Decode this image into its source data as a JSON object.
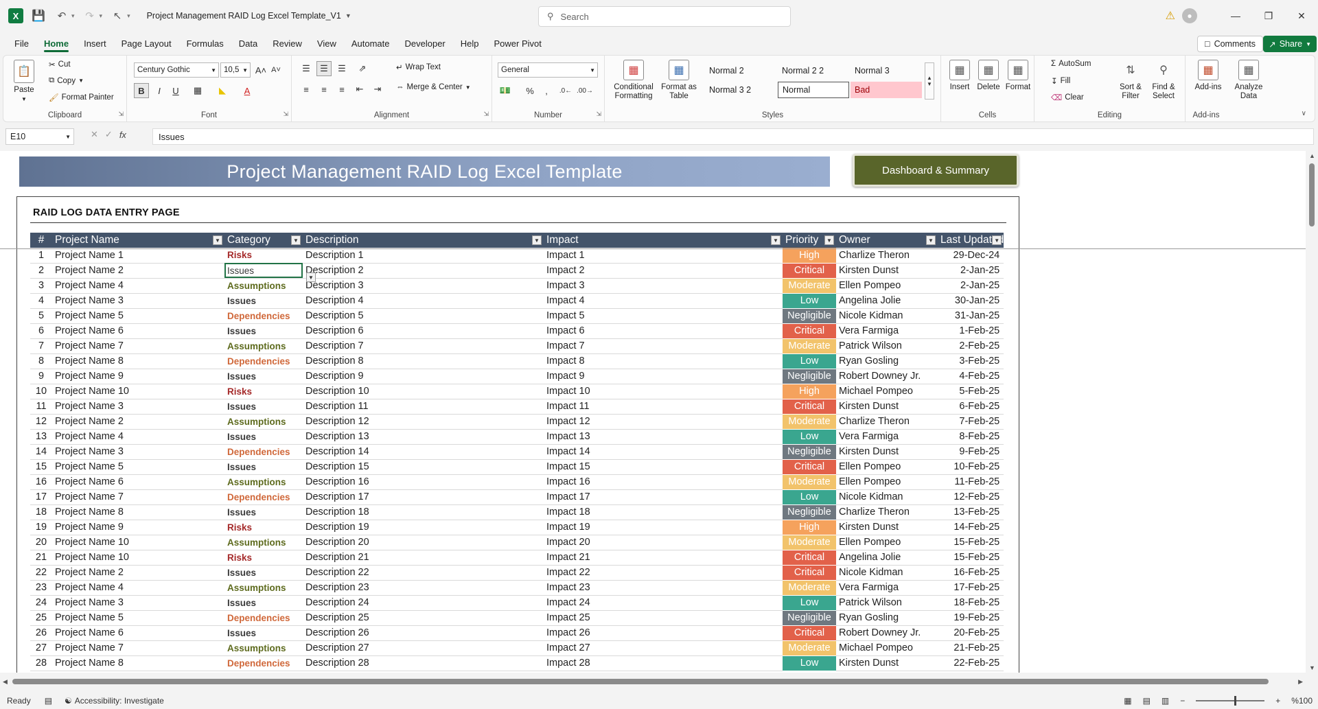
{
  "app": {
    "title": "Project Management RAID Log Excel Template_V1",
    "search_placeholder": "Search",
    "comments_label": "Comments",
    "share_label": "Share"
  },
  "menu": [
    "File",
    "Home",
    "Insert",
    "Page Layout",
    "Formulas",
    "Data",
    "Review",
    "View",
    "Automate",
    "Developer",
    "Help",
    "Power Pivot"
  ],
  "ribbon": {
    "clipboard": {
      "paste": "Paste",
      "cut": "Cut",
      "copy": "Copy",
      "format_painter": "Format Painter",
      "label": "Clipboard"
    },
    "font": {
      "name": "Century Gothic",
      "size": "10,5",
      "label": "Font"
    },
    "alignment": {
      "wrap_text": "Wrap Text",
      "merge_center": "Merge & Center",
      "label": "Alignment"
    },
    "number": {
      "format": "General",
      "label": "Number"
    },
    "styles": {
      "conditional_formatting": "Conditional Formatting",
      "format_as_table": "Format as Table",
      "cells": [
        "Normal 2",
        "Normal 2 2",
        "Normal 3",
        "Normal 3 2",
        "Normal",
        "Bad"
      ],
      "label": "Styles"
    },
    "cells": {
      "insert": "Insert",
      "delete": "Delete",
      "format": "Format",
      "label": "Cells"
    },
    "editing": {
      "autosum": "AutoSum",
      "fill": "Fill",
      "clear": "Clear",
      "sort_filter": "Sort & Filter",
      "find_select": "Find & Select",
      "label": "Editing"
    },
    "addins": {
      "addins": "Add-ins",
      "analyze": "Analyze Data",
      "label": "Add-ins"
    }
  },
  "formula_bar": {
    "name_box": "E10",
    "value": "Issues"
  },
  "sheet": {
    "banner_title": "Project Management RAID Log Excel Template",
    "dashboard_button": "Dashboard & Summary",
    "entry_title": "RAID LOG DATA ENTRY PAGE",
    "headers": [
      "#",
      "Project Name",
      "Category",
      "Description",
      "Impact",
      "Priority",
      "Owner",
      "Last Updated"
    ],
    "rows": [
      [
        "1",
        "Project Name 1",
        "Risks",
        "Description 1",
        "Impact 1",
        "High",
        "Charlize Theron",
        "29-Dec-24"
      ],
      [
        "2",
        "Project Name 2",
        "Issues",
        "Description 2",
        "Impact 2",
        "Critical",
        "Kirsten Dunst",
        "2-Jan-25"
      ],
      [
        "3",
        "Project Name 4",
        "Assumptions",
        "Description 3",
        "Impact 3",
        "Moderate",
        "Ellen Pompeo",
        "2-Jan-25"
      ],
      [
        "4",
        "Project Name 3",
        "Issues",
        "Description 4",
        "Impact 4",
        "Low",
        "Angelina Jolie",
        "30-Jan-25"
      ],
      [
        "5",
        "Project Name 5",
        "Dependencies",
        "Description 5",
        "Impact 5",
        "Negligible",
        "Nicole Kidman",
        "31-Jan-25"
      ],
      [
        "6",
        "Project Name 6",
        "Issues",
        "Description 6",
        "Impact 6",
        "Critical",
        "Vera Farmiga",
        "1-Feb-25"
      ],
      [
        "7",
        "Project Name 7",
        "Assumptions",
        "Description 7",
        "Impact 7",
        "Moderate",
        "Patrick Wilson",
        "2-Feb-25"
      ],
      [
        "8",
        "Project Name 8",
        "Dependencies",
        "Description 8",
        "Impact 8",
        "Low",
        "Ryan Gosling",
        "3-Feb-25"
      ],
      [
        "9",
        "Project Name 9",
        "Issues",
        "Description 9",
        "Impact 9",
        "Negligible",
        "Robert Downey Jr.",
        "4-Feb-25"
      ],
      [
        "10",
        "Project Name 10",
        "Risks",
        "Description 10",
        "Impact 10",
        "High",
        "Michael Pompeo",
        "5-Feb-25"
      ],
      [
        "11",
        "Project Name 3",
        "Issues",
        "Description 11",
        "Impact 11",
        "Critical",
        "Kirsten Dunst",
        "6-Feb-25"
      ],
      [
        "12",
        "Project Name 2",
        "Assumptions",
        "Description 12",
        "Impact 12",
        "Moderate",
        "Charlize Theron",
        "7-Feb-25"
      ],
      [
        "13",
        "Project Name 4",
        "Issues",
        "Description 13",
        "Impact 13",
        "Low",
        "Vera Farmiga",
        "8-Feb-25"
      ],
      [
        "14",
        "Project Name 3",
        "Dependencies",
        "Description 14",
        "Impact 14",
        "Negligible",
        "Kirsten Dunst",
        "9-Feb-25"
      ],
      [
        "15",
        "Project Name 5",
        "Issues",
        "Description 15",
        "Impact 15",
        "Critical",
        "Ellen Pompeo",
        "10-Feb-25"
      ],
      [
        "16",
        "Project Name 6",
        "Assumptions",
        "Description 16",
        "Impact 16",
        "Moderate",
        "Ellen Pompeo",
        "11-Feb-25"
      ],
      [
        "17",
        "Project Name 7",
        "Dependencies",
        "Description 17",
        "Impact 17",
        "Low",
        "Nicole Kidman",
        "12-Feb-25"
      ],
      [
        "18",
        "Project Name 8",
        "Issues",
        "Description 18",
        "Impact 18",
        "Negligible",
        "Charlize Theron",
        "13-Feb-25"
      ],
      [
        "19",
        "Project Name 9",
        "Risks",
        "Description 19",
        "Impact 19",
        "High",
        "Kirsten Dunst",
        "14-Feb-25"
      ],
      [
        "20",
        "Project Name 10",
        "Assumptions",
        "Description 20",
        "Impact 20",
        "Moderate",
        "Ellen Pompeo",
        "15-Feb-25"
      ],
      [
        "21",
        "Project Name 10",
        "Risks",
        "Description 21",
        "Impact 21",
        "Critical",
        "Angelina Jolie",
        "15-Feb-25"
      ],
      [
        "22",
        "Project Name 2",
        "Issues",
        "Description 22",
        "Impact 22",
        "Critical",
        "Nicole Kidman",
        "16-Feb-25"
      ],
      [
        "23",
        "Project Name 4",
        "Assumptions",
        "Description 23",
        "Impact 23",
        "Moderate",
        "Vera Farmiga",
        "17-Feb-25"
      ],
      [
        "24",
        "Project Name 3",
        "Issues",
        "Description 24",
        "Impact 24",
        "Low",
        "Patrick Wilson",
        "18-Feb-25"
      ],
      [
        "25",
        "Project Name 5",
        "Dependencies",
        "Description 25",
        "Impact 25",
        "Negligible",
        "Ryan Gosling",
        "19-Feb-25"
      ],
      [
        "26",
        "Project Name 6",
        "Issues",
        "Description 26",
        "Impact 26",
        "Critical",
        "Robert Downey Jr.",
        "20-Feb-25"
      ],
      [
        "27",
        "Project Name 7",
        "Assumptions",
        "Description 27",
        "Impact 27",
        "Moderate",
        "Michael Pompeo",
        "21-Feb-25"
      ],
      [
        "28",
        "Project Name 8",
        "Dependencies",
        "Description 28",
        "Impact 28",
        "Low",
        "Kirsten Dunst",
        "22-Feb-25"
      ]
    ],
    "category_colors": {
      "Risks": "#a52a2a",
      "Issues": "#3a3a3a",
      "Assumptions": "#5e6b1e",
      "Dependencies": "#d0683a"
    },
    "priority_colors": {
      "High": "#f5a25d",
      "Critical": "#e2614a",
      "Moderate": "#f2c36b",
      "Low": "#3aa68f",
      "Negligible": "#6f7880"
    },
    "selected_cell": {
      "row": 2,
      "col": 2
    }
  },
  "status": {
    "ready": "Ready",
    "accessibility": "Accessibility: Investigate",
    "zoom": "%100"
  }
}
